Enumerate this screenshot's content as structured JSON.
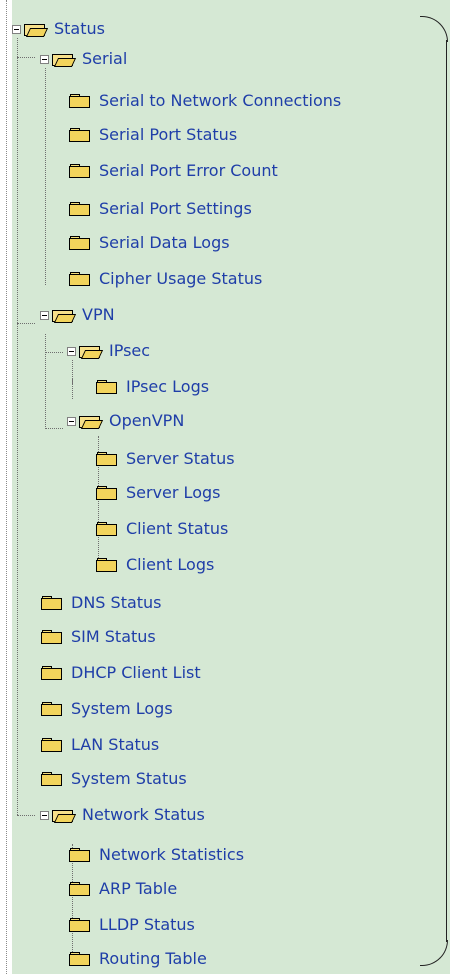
{
  "tree": {
    "root": {
      "label": "Status",
      "children": [
        {
          "label": "Serial",
          "children": [
            {
              "label": "Serial to Network Connections"
            },
            {
              "label": "Serial Port Status"
            },
            {
              "label": "Serial Port Error Count"
            },
            {
              "label": "Serial Port Settings"
            },
            {
              "label": "Serial Data Logs"
            },
            {
              "label": "Cipher Usage Status"
            }
          ]
        },
        {
          "label": "VPN",
          "children": [
            {
              "label": "IPsec",
              "children": [
                {
                  "label": "IPsec Logs"
                }
              ]
            },
            {
              "label": "OpenVPN",
              "children": [
                {
                  "label": "Server Status"
                },
                {
                  "label": "Server Logs"
                },
                {
                  "label": "Client Status"
                },
                {
                  "label": "Client Logs"
                }
              ]
            }
          ]
        },
        {
          "label": "DNS Status"
        },
        {
          "label": "SIM Status"
        },
        {
          "label": "DHCP Client List"
        },
        {
          "label": "System Logs"
        },
        {
          "label": "LAN Status"
        },
        {
          "label": "System Status"
        },
        {
          "label": "Network Status",
          "children": [
            {
              "label": "Network Statistics"
            },
            {
              "label": "ARP Table"
            },
            {
              "label": "LLDP Status"
            },
            {
              "label": "Routing Table"
            }
          ]
        }
      ]
    }
  },
  "colors": {
    "panel_background": "#d5e8d4",
    "label_text": "#1f3ea8",
    "folder_fill": "#f2d45c",
    "connector_lines": "#6f6f6f"
  },
  "icons": {
    "expanded_toggle": "minus-box-icon",
    "expanded_folder": "folder-open-icon",
    "leaf_folder": "folder-icon"
  }
}
